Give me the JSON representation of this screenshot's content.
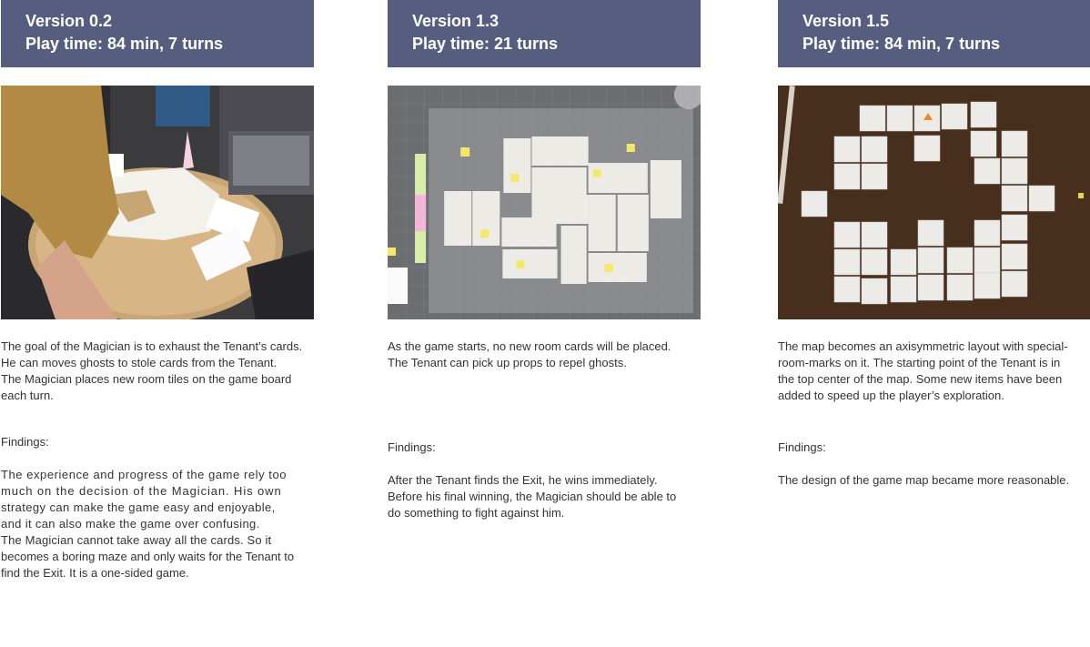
{
  "columns": [
    {
      "version": "Version 0.2",
      "playtime": "Play time: 84 min, 7 turns",
      "photo_alt": "",
      "description": [
        "The goal of the Magician is to exhaust the Tenant’s cards.",
        "He can moves ghosts to stole cards from the Tenant.",
        "The Magician places new room tiles on the game board",
        "each turn."
      ],
      "findings_label": "Findings:",
      "findings": [
        "The experience and progress of the game rely too",
        "much on the decision of the Magician. His own",
        "strategy can make the game easy and enjoyable,",
        "and it can also make the game over confusing.",
        "The Magician cannot take away all the cards. So it",
        "becomes a boring maze and only waits for the Tenant to",
        "find the Exit. It is a one-sided game."
      ]
    },
    {
      "version": "Version 1.3",
      "playtime": "Play time: 21 turns",
      "description": [
        "As the game starts, no new room cards will be placed.",
        "The Tenant can pick up props to repel ghosts."
      ],
      "findings_label": "Findings:",
      "findings": [
        "After the Tenant finds the Exit, he wins immediately.",
        "Before his final winning, the Magician should be able to",
        "do something to fight against him."
      ]
    },
    {
      "version": "Version 1.5",
      "playtime": "Play time: 84 min, 7 turns",
      "description": [
        "The map becomes an axisymmetric layout with special-",
        "room-marks on it. The starting point of the Tenant is in",
        "the top center of the map. Some new items have been",
        "added to speed up the player’s exploration."
      ],
      "findings_label": "Findings:",
      "findings": [
        "The design of the game map became more reasonable."
      ]
    }
  ],
  "colors": {
    "header_bg": "#575d7e",
    "header_text": "#ffffff",
    "body_text": "#333333"
  }
}
